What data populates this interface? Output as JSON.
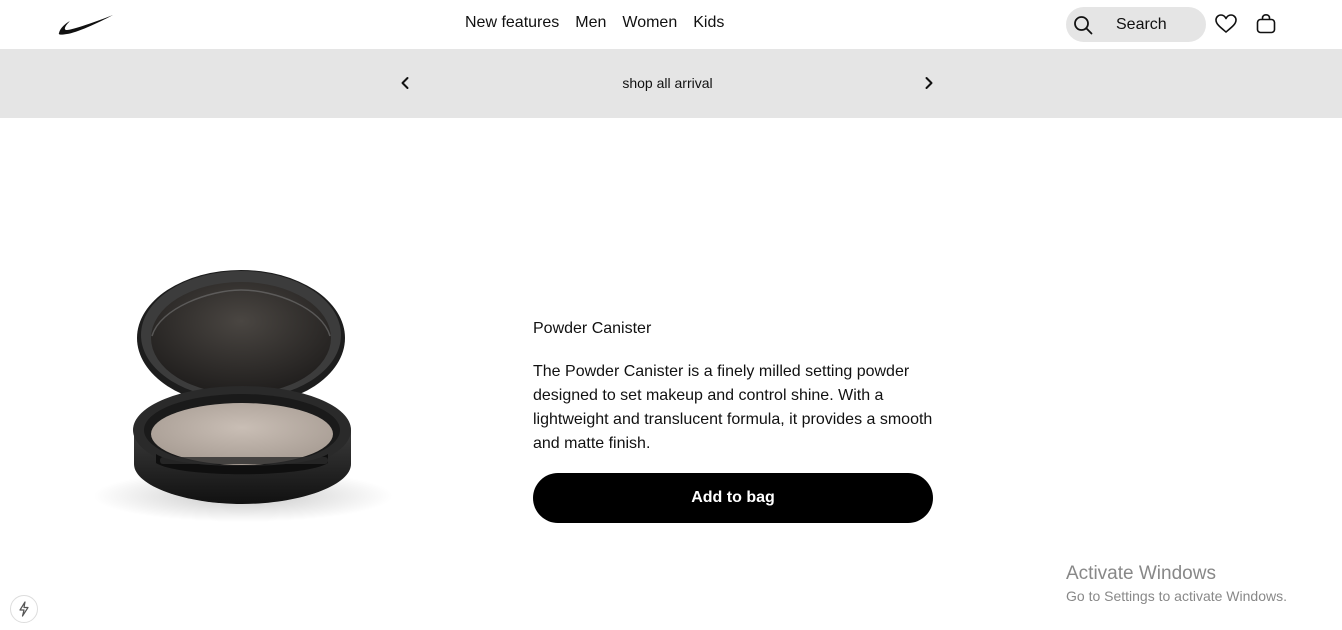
{
  "header": {
    "logo": "nike-swoosh-logo",
    "nav": [
      "New features",
      "Men",
      "Women",
      "Kids"
    ],
    "search_placeholder": "Search",
    "icons": [
      "search-icon",
      "heart-icon",
      "bag-icon"
    ]
  },
  "banner": {
    "text": "shop all arrival",
    "icons": [
      "chevron-left-icon",
      "chevron-right-icon"
    ]
  },
  "product": {
    "title": "Powder Canister",
    "description": "The Powder Canister is a finely milled setting powder designed to set makeup and control shine. With a lightweight and translucent formula, it provides a smooth and matte finish.",
    "button_label": "Add to bag"
  },
  "overlay": {
    "activate_title": "Activate Windows",
    "activate_sub": "Go to Settings to activate Windows.",
    "lightning_icon": "lightning-icon"
  },
  "colors": {
    "banner_bg": "#e5e5e5",
    "button_bg": "#000000",
    "text": "#111111"
  }
}
